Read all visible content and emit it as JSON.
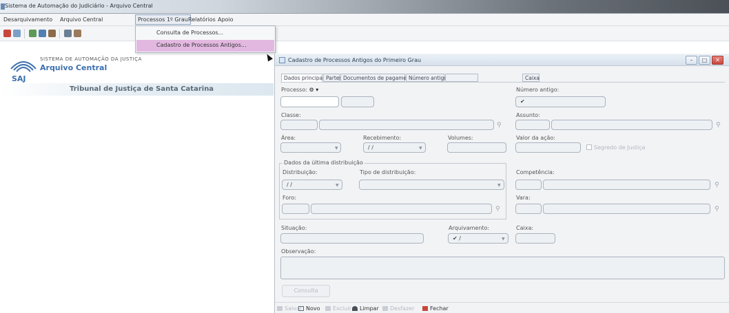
{
  "app": {
    "title": "Sistema de Automação do Judiciário - Arquivo Central"
  },
  "menubar": {
    "items": [
      "Desarquivamento",
      "Arquivo Central",
      "Processos 1º Grau",
      "Relatórios",
      "Apoio"
    ]
  },
  "dropdown": {
    "items": [
      "Consulta de Processos...",
      "Cadastro de Processos Antigos..."
    ],
    "highlighted_index": 1
  },
  "header": {
    "system_text": "SISTEMA DE AUTOMAÇÃO DA JUSTIÇA",
    "app_name": "Arquivo Central",
    "logo_text": "SAJ",
    "court": "Tribunal de Justiça de Santa Catarina"
  },
  "window": {
    "title": "Cadastro de Processos Antigos do Primeiro Grau",
    "tabs": [
      {
        "label": "Dados principais",
        "state": "active"
      },
      {
        "label": "Partes",
        "state": "normal"
      },
      {
        "label": "Documentos de pagamento",
        "state": "normal"
      },
      {
        "label": "Número antigo",
        "state": "normal"
      },
      {
        "label": "",
        "state": "disabled"
      },
      {
        "label": "Caixa",
        "state": "normal"
      }
    ]
  },
  "form": {
    "processo_label": "Processo:",
    "numero_antigo_label": "Número antigo:",
    "numero_antigo_value": "✔",
    "classe_label": "Classe:",
    "assunto_label": "Assunto:",
    "area_label": "Área:",
    "recebimento_label": "Recebimento:",
    "recebimento_value": "/ /",
    "volumes_label": "Volumes:",
    "valor_acao_label": "Valor da ação:",
    "segredo_label": "Segredo de Justiça",
    "group_title": "Dados da última distribuição",
    "distribuicao_label": "Distribuição:",
    "distribuicao_value": "/ /",
    "tipo_distribuicao_label": "Tipo de distribuição:",
    "competencia_label": "Competência:",
    "foro_label": "Foro:",
    "vara_label": "Vara:",
    "situacao_label": "Situação:",
    "arquivamento_label": "Arquivamento:",
    "arquivamento_value": "✔ /",
    "caixa_label": "Caixa:",
    "observacao_label": "Observação:",
    "consulta_button": "Consulta"
  },
  "bottom_toolbar": {
    "items": [
      {
        "label": "Salvar",
        "enabled": false
      },
      {
        "label": "Novo",
        "enabled": true
      },
      {
        "label": "Excluir",
        "enabled": false
      },
      {
        "label": "Limpar",
        "enabled": true
      },
      {
        "label": "Desfazer",
        "enabled": false
      },
      {
        "label": "Fechar",
        "enabled": true
      }
    ]
  },
  "colors": {
    "brand_blue": "#3c6fae",
    "menu_highlight": "#e2b8e0",
    "close_red": "#c9463b"
  }
}
